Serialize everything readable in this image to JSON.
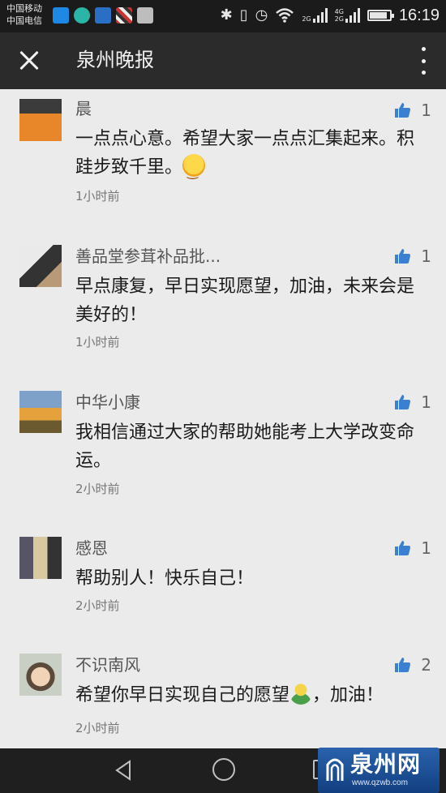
{
  "status_bar": {
    "carrier_1": "中国移动",
    "carrier_2": "中国电信",
    "network_1": "2G",
    "network_2a": "4G",
    "network_2b": "2G",
    "time": "16:19"
  },
  "header": {
    "title": "泉州晚报",
    "close_icon": "close-icon",
    "menu_icon": "more-vertical-icon"
  },
  "comments": [
    {
      "name": "晨",
      "likes": "1",
      "text_main": "一点点心意。希望大家一点点汇集起来。积跬步致千里。",
      "text_after": "",
      "emoji": "smile-emoji",
      "time": "1小时前"
    },
    {
      "name": "善品堂参茸补品批...",
      "likes": "1",
      "text_main": "早点康复，早日实现愿望，加油，未来会是美好的！",
      "text_after": "",
      "emoji": "",
      "time": "1小时前"
    },
    {
      "name": "中华小康",
      "likes": "1",
      "text_main": "我相信通过大家的帮助她能考上大学改变命运。",
      "text_after": "",
      "emoji": "",
      "time": "2小时前"
    },
    {
      "name": "感恩",
      "likes": "1",
      "text_main": "帮助别人！快乐自己！",
      "text_after": "",
      "emoji": "",
      "time": "2小时前"
    },
    {
      "name": "不识南风",
      "likes": "2",
      "text_main": "希望你早日实现自己的愿望",
      "text_after": "，加油！",
      "emoji": "person-emoji",
      "time": "2小时前"
    }
  ],
  "watermark": {
    "text": "泉州网",
    "url": "www.qzwb.com"
  },
  "colors": {
    "accent_like": "#3b7fd1",
    "header_bg": "#2b2b2b",
    "list_bg": "#ebebeb"
  }
}
